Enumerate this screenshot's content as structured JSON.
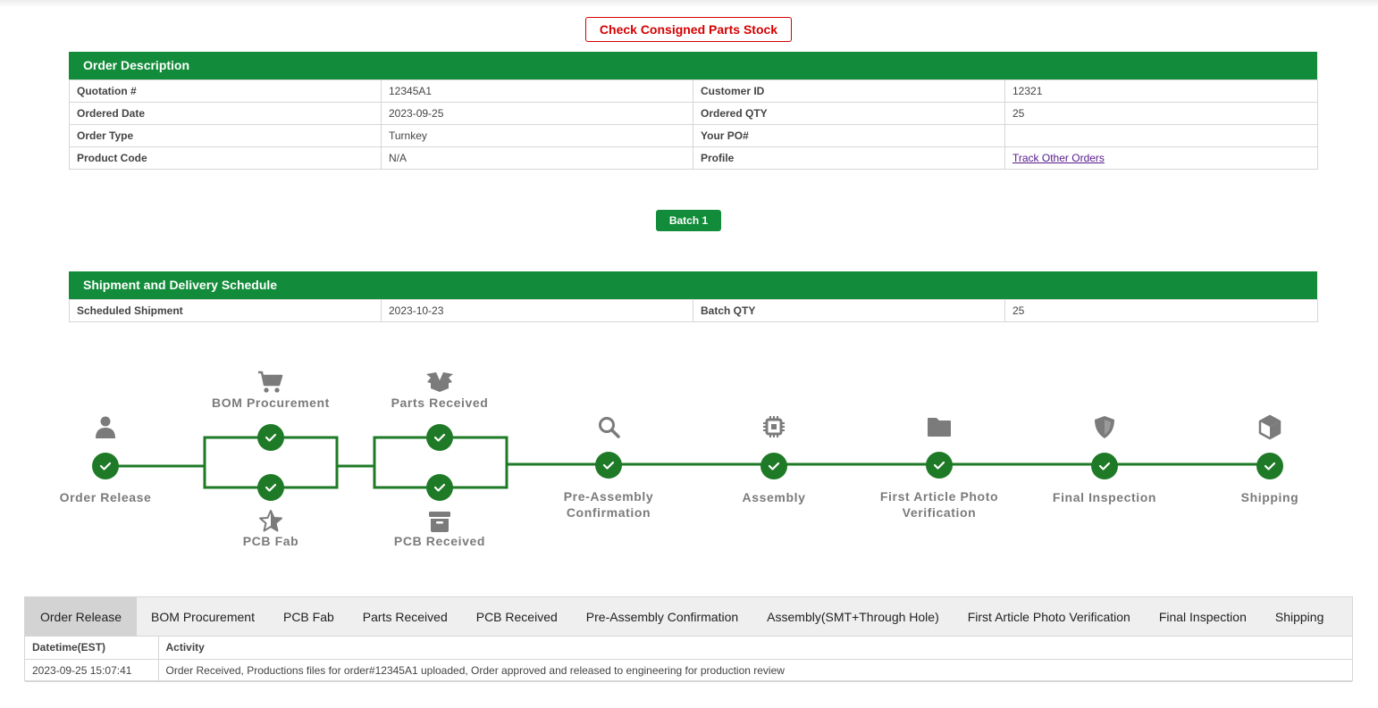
{
  "consigned_button": "Check Consigned Parts Stock",
  "order": {
    "title": "Order Description",
    "rows": [
      {
        "l1": "Quotation #",
        "v1": "12345A1",
        "l2": "Customer ID",
        "v2": "12321"
      },
      {
        "l1": "Ordered Date",
        "v1": "2023-09-25",
        "l2": "Ordered QTY",
        "v2": "25"
      },
      {
        "l1": "Order Type",
        "v1": "Turnkey",
        "l2": "Your PO#",
        "v2": ""
      },
      {
        "l1": "Product Code",
        "v1": "N/A",
        "l2": "Profile",
        "v2": "Track Other Orders"
      }
    ]
  },
  "batch_button": "Batch 1",
  "shipment": {
    "title": "Shipment and Delivery Schedule",
    "scheduled_label": "Scheduled Shipment",
    "scheduled_value": "2023-10-23",
    "qty_label": "Batch QTY",
    "qty_value": "25"
  },
  "timeline": {
    "accent_color": "#1e7a26",
    "icon_color": "#7b7b7b",
    "steps": {
      "order_release": {
        "line1": "Order Release",
        "icon": "user-icon",
        "done": true
      },
      "bom_procurement": {
        "line1": "BOM Procurement",
        "icon": "shopping-cart-icon",
        "done": true
      },
      "pcb_fab": {
        "line1": "PCB Fab",
        "icon": "star-icon",
        "done": true
      },
      "parts_received": {
        "line1": "Parts Received",
        "icon": "open-box-icon",
        "done": true
      },
      "pcb_received": {
        "line1": "PCB Received",
        "icon": "archive-icon",
        "done": true
      },
      "pre_assembly": {
        "line1": "Pre-Assembly",
        "line2": "Confirmation",
        "icon": "search-icon",
        "done": true
      },
      "assembly": {
        "line1": "Assembly",
        "icon": "chip-icon",
        "done": true
      },
      "first_article": {
        "line1": "First Article Photo",
        "line2": "Verification",
        "icon": "folder-icon",
        "done": true
      },
      "final_inspection": {
        "line1": "Final Inspection",
        "icon": "shield-icon",
        "done": true
      },
      "shipping": {
        "line1": "Shipping",
        "icon": "cube-icon",
        "done": true
      }
    }
  },
  "tabs": [
    "Order Release",
    "BOM Procurement",
    "PCB Fab",
    "Parts Received",
    "PCB Received",
    "Pre-Assembly Confirmation",
    "Assembly(SMT+Through Hole)",
    "First Article Photo Verification",
    "Final Inspection",
    "Shipping"
  ],
  "activity": {
    "col_datetime": "Datetime(EST)",
    "col_activity": "Activity",
    "rows": [
      {
        "datetime": "2023-09-25 15:07:41",
        "activity": "Order Received, Productions files for order#12345A1 uploaded, Order approved and released to engineering for production review"
      }
    ]
  }
}
